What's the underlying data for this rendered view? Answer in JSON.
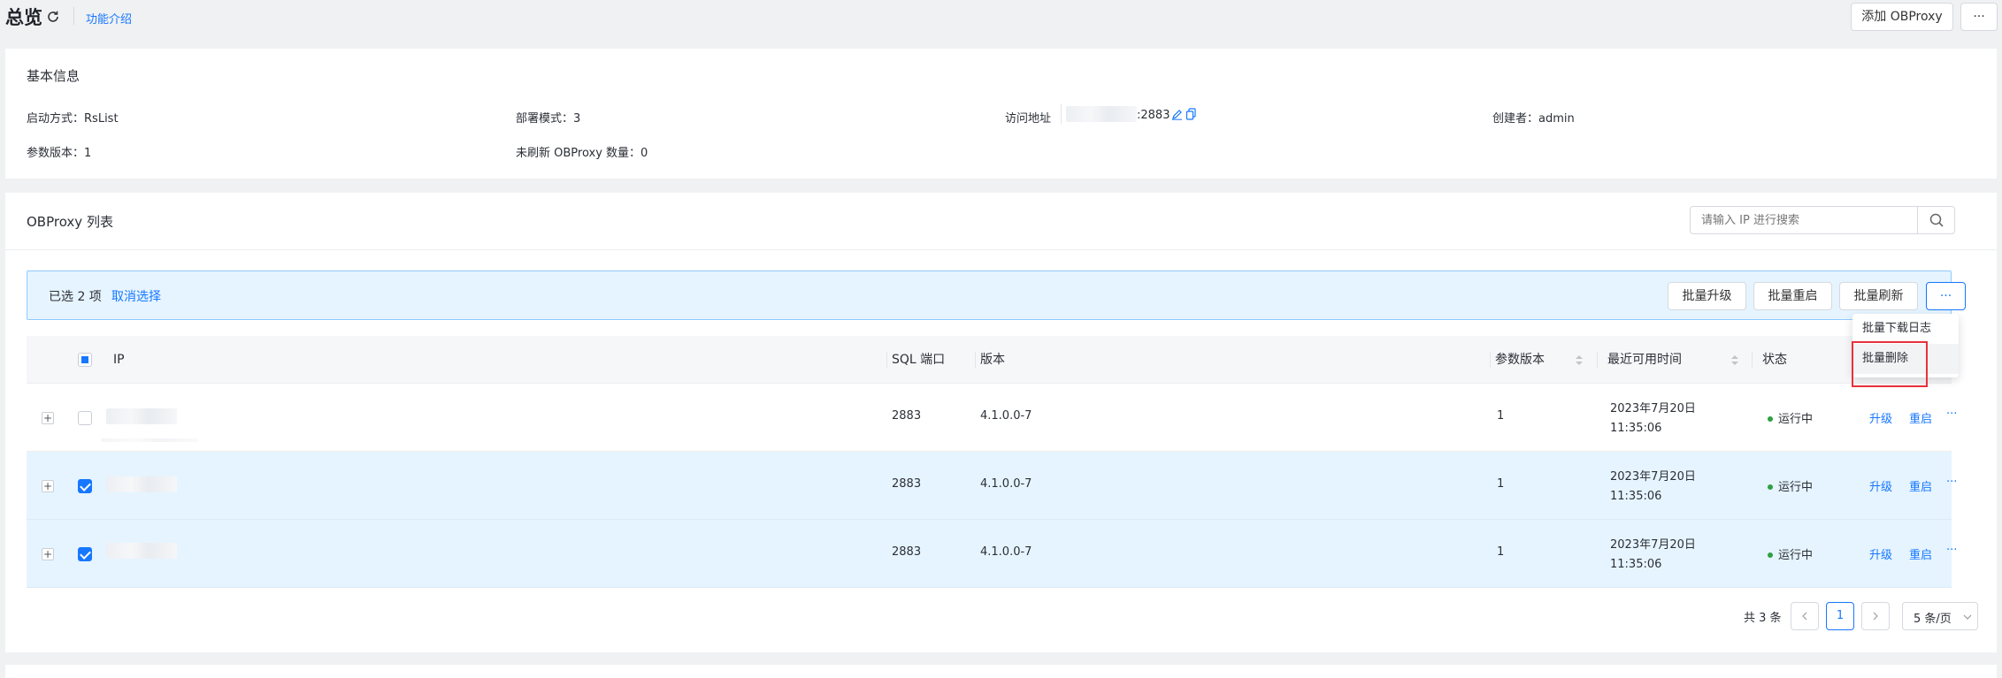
{
  "header": {
    "title": "总览",
    "feature_intro": "功能介绍",
    "add_button": "添加 OBProxy",
    "more_button": "···"
  },
  "basic_info": {
    "title": "基本信息",
    "startup_label": "启动方式：",
    "startup_value": "RsList",
    "deploy_label": "部署模式：",
    "deploy_value": "3",
    "access_label": "访问地址",
    "access_port": ":2883",
    "creator_label": "创建者：",
    "creator_value": "admin",
    "param_label": "参数版本：",
    "param_value": "1",
    "unrefreshed_label": "未刷新 OBProxy 数量：",
    "unrefreshed_value": "0"
  },
  "list": {
    "title": "OBProxy 列表",
    "search_placeholder": "请输入 IP 进行搜索",
    "selection_text": "已选 2 项",
    "cancel_selection": "取消选择",
    "batch_upgrade": "批量升级",
    "batch_restart": "批量重启",
    "batch_refresh": "批量刷新",
    "batch_more": "···",
    "dropdown": [
      "批量下载日志",
      "批量删除"
    ],
    "columns": {
      "ip": "IP",
      "sql_port": "SQL 端口",
      "version": "版本",
      "param_version": "参数版本",
      "last_available": "最近可用时间",
      "status": "状态"
    },
    "rows": [
      {
        "sql_port": "2883",
        "version": "4.1.0.0-7",
        "param_version": "1",
        "date": "2023年7月20日",
        "time": "11:35:06",
        "status": "运行中",
        "upgrade": "升级",
        "restart": "重启",
        "more": "···",
        "selected": false
      },
      {
        "sql_port": "2883",
        "version": "4.1.0.0-7",
        "param_version": "1",
        "date": "2023年7月20日",
        "time": "11:35:06",
        "status": "运行中",
        "upgrade": "升级",
        "restart": "重启",
        "more": "···",
        "selected": true
      },
      {
        "sql_port": "2883",
        "version": "4.1.0.0-7",
        "param_version": "1",
        "date": "2023年7月20日",
        "time": "11:35:06",
        "status": "运行中",
        "upgrade": "升级",
        "restart": "重启",
        "more": "···",
        "selected": true
      }
    ],
    "pagination": {
      "total": "共 3 条",
      "current_page": "1",
      "page_size": "5 条/页"
    }
  },
  "colors": {
    "accent": "#1677ff",
    "selected_row": "#e6f4ff",
    "status_ok": "#2ea043",
    "highlight_box": "#e8323c"
  }
}
